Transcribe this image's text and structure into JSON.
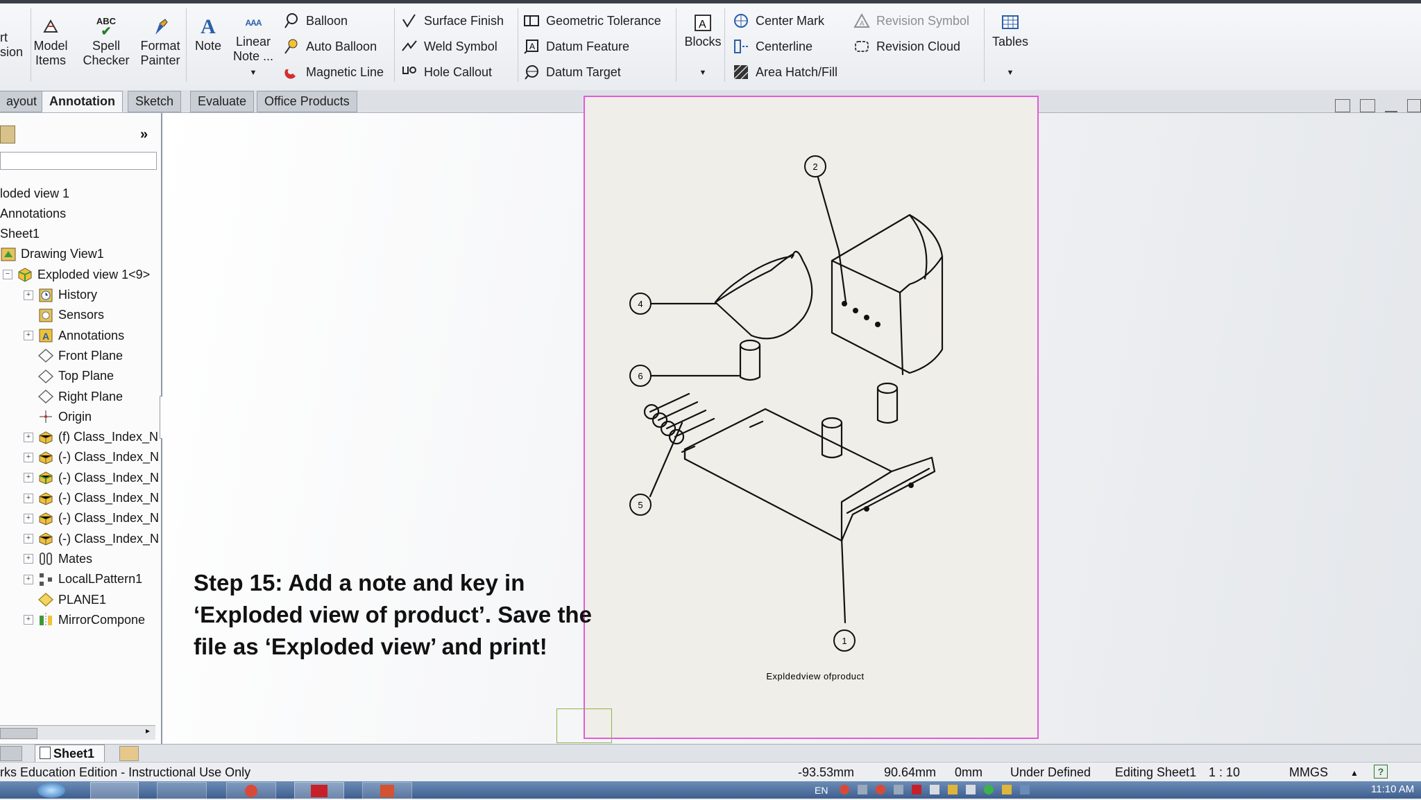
{
  "ribbon": {
    "partial_left": [
      "rt",
      "sion"
    ],
    "model_items": [
      "Model",
      "Items"
    ],
    "spell_checker": [
      "Spell",
      "Checker"
    ],
    "spell_glyph": "ABC",
    "format_painter": [
      "Format",
      "Painter"
    ],
    "note": "Note",
    "linear_note": [
      "Linear",
      "Note ..."
    ],
    "linear_glyph": "AAA",
    "col1": [
      "Balloon",
      "Auto Balloon",
      "Magnetic Line"
    ],
    "col2": [
      "Surface Finish",
      "Weld Symbol",
      "Hole Callout"
    ],
    "col3": [
      "Geometric Tolerance",
      "Datum Feature",
      "Datum Target"
    ],
    "blocks": "Blocks",
    "col4": [
      "Center Mark",
      "Centerline",
      "Area Hatch/Fill"
    ],
    "col5": [
      "Revision Symbol",
      "Revision Cloud"
    ],
    "tables": "Tables"
  },
  "tabs": [
    "ayout",
    "Annotation",
    "Sketch",
    "Evaluate",
    "Office Products"
  ],
  "active_tab": "Annotation",
  "tree": {
    "rows": [
      {
        "label": "loded view 1",
        "indent": 0,
        "icon": "none"
      },
      {
        "label": "Annotations",
        "indent": 0,
        "icon": "none"
      },
      {
        "label": "Sheet1",
        "indent": 0,
        "icon": "none"
      },
      {
        "label": "Drawing View1",
        "indent": 1,
        "icon": "drawing-view-icon"
      },
      {
        "label": "Exploded view 1<9>",
        "indent": 2,
        "icon": "assembly-icon",
        "expander": "−"
      },
      {
        "label": "History",
        "indent": 3,
        "icon": "history-icon",
        "expander": "+"
      },
      {
        "label": "Sensors",
        "indent": 3,
        "icon": "sensor-icon"
      },
      {
        "label": "Annotations",
        "indent": 3,
        "icon": "annotation-icon",
        "expander": "+"
      },
      {
        "label": "Front Plane",
        "indent": 3,
        "icon": "plane-icon"
      },
      {
        "label": "Top Plane",
        "indent": 3,
        "icon": "plane-icon"
      },
      {
        "label": "Right Plane",
        "indent": 3,
        "icon": "plane-icon"
      },
      {
        "label": "Origin",
        "indent": 3,
        "icon": "origin-icon"
      },
      {
        "label": "(f) Class_Index_N",
        "indent": 3,
        "icon": "part-icon",
        "expander": "+"
      },
      {
        "label": "(-) Class_Index_N",
        "indent": 3,
        "icon": "part-icon",
        "expander": "+"
      },
      {
        "label": "(-) Class_Index_N",
        "indent": 3,
        "icon": "part-green-icon",
        "expander": "+"
      },
      {
        "label": "(-) Class_Index_N",
        "indent": 3,
        "icon": "part-icon",
        "expander": "+"
      },
      {
        "label": "(-) Class_Index_N",
        "indent": 3,
        "icon": "part-icon",
        "expander": "+"
      },
      {
        "label": "(-) Class_Index_N",
        "indent": 3,
        "icon": "part-icon",
        "expander": "+"
      },
      {
        "label": "Mates",
        "indent": 3,
        "icon": "mates-icon",
        "expander": "+"
      },
      {
        "label": "LocalLPattern1",
        "indent": 3,
        "icon": "pattern-icon",
        "expander": "+"
      },
      {
        "label": "PLANE1",
        "indent": 3,
        "icon": "plane-yellow-icon"
      },
      {
        "label": "MirrorCompone",
        "indent": 3,
        "icon": "mirror-icon",
        "expander": "+"
      }
    ]
  },
  "drawing": {
    "balloons": [
      "2",
      "4",
      "6",
      "5",
      "1"
    ],
    "caption": "Expldedview ofproduct"
  },
  "step_note": [
    "Step 15:  Add a note and key in",
    "‘Exploded view of product’. Save the",
    "file as ‘Exploded view’ and print!"
  ],
  "sheet_tab": "Sheet1",
  "status": {
    "edition": "rks Education Edition - Instructional Use Only",
    "x": "-93.53mm",
    "y": "90.64mm",
    "z": "0mm",
    "state": "Under Defined",
    "editing": "Editing Sheet1",
    "scale": "1 : 10",
    "units": "MMGS"
  },
  "taskbar": {
    "lang": "EN",
    "time": "11:10 AM"
  },
  "colors": {
    "sheet_border": "#e25bd9",
    "accent": "#2b5ea8"
  }
}
